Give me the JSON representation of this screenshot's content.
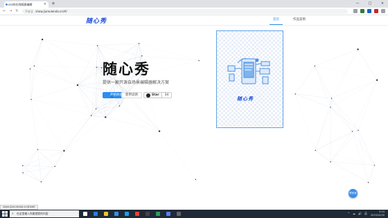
{
  "browser": {
    "tab_title": "xss的在线随意编辑",
    "tab_close": "×",
    "new_tab": "+",
    "window_controls": [
      "—",
      "□",
      "×"
    ],
    "nav_icons": [
      "←",
      "→",
      "↻",
      "⌂"
    ],
    "security_label": "不安全",
    "url": "show.jiumulenda.cn/#/",
    "extensions": [
      {
        "name": "star-icon",
        "color": "#9aa0a6"
      },
      {
        "name": "extension-a-icon",
        "color": "#2e7d32"
      },
      {
        "name": "extension-b-icon",
        "color": "#1565c0"
      },
      {
        "name": "extension-c-icon",
        "color": "#c62828"
      },
      {
        "name": "menu-icon",
        "color": "#9aa0a6"
      }
    ]
  },
  "header": {
    "logo": "随心秀",
    "nav": [
      {
        "label": "首页",
        "active": true
      },
      {
        "label": "作品案例",
        "active": false
      }
    ]
  },
  "hero": {
    "title": "随心秀",
    "subtitle": "提供一款开源自场景编辑器解决方案",
    "start_button": "开始体验",
    "docs_button": "使用说明",
    "github_star_label": "Star",
    "github_star_count": "34"
  },
  "card": {
    "logo": "随心秀"
  },
  "float_button": "联系我",
  "status_url": "show.jiumulenda.cn/#/edit",
  "taskbar": {
    "search_placeholder": "在这里输入你要搜索的内容",
    "apps": [
      {
        "name": "task-view-icon",
        "color": "#ffffff"
      },
      {
        "name": "edge-icon",
        "color": "#2a7de1"
      },
      {
        "name": "explorer-icon",
        "color": "#f2c230"
      },
      {
        "name": "store-icon",
        "color": "#3b8ee8"
      },
      {
        "name": "vscode-icon",
        "color": "#1f9cf0"
      },
      {
        "name": "chrome-icon",
        "color": "#e94235"
      },
      {
        "name": "terminal-icon",
        "color": "#444444"
      },
      {
        "name": "app-green-icon",
        "color": "#2e9d5b"
      },
      {
        "name": "app-blue-icon",
        "color": "#5c7cfa"
      },
      {
        "name": "app-dark-icon",
        "color": "#666666"
      }
    ],
    "time": "5:24",
    "date": "2019/10/30",
    "tray_icons": [
      "^",
      "☁",
      "🔊",
      "英"
    ]
  },
  "colors": {
    "accent": "#2b8ef0",
    "logo_blue": "#1d4fd8",
    "taskbar": "#1f2a36"
  }
}
